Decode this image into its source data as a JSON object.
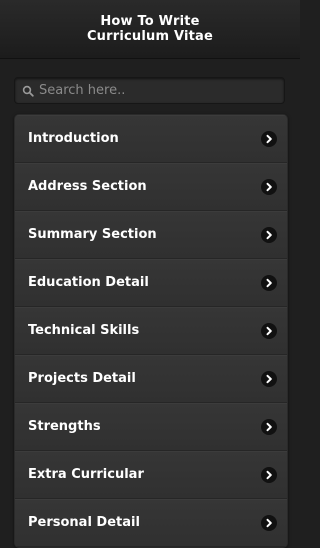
{
  "header": {
    "title_line1": "How To Write",
    "title_line2": "Curriculum Vitae"
  },
  "search": {
    "placeholder": "Search here.."
  },
  "menu": {
    "items": [
      {
        "label": "Introduction"
      },
      {
        "label": "Address Section"
      },
      {
        "label": "Summary Section"
      },
      {
        "label": "Education Detail"
      },
      {
        "label": "Technical Skills"
      },
      {
        "label": "Projects Detail"
      },
      {
        "label": "Strengths"
      },
      {
        "label": "Extra Curricular"
      },
      {
        "label": "Personal Detail"
      }
    ],
    "item_icon": "chevron-right-icon"
  },
  "colors": {
    "background": "#1f1f1f",
    "list_item": "#333333",
    "text": "#ffffff"
  }
}
